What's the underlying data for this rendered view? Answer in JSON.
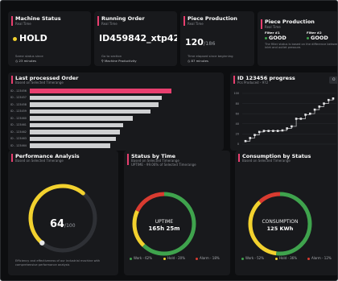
{
  "colors": {
    "accent": "#e83f6f",
    "yellow": "#f2d12e",
    "green": "#3fa34d",
    "red": "#d93b30",
    "orange": "#e07a1f",
    "bar": "#cfd0d2"
  },
  "machine_status": {
    "title": "Machine Status",
    "subtitle": "Real Time",
    "value": "HOLD",
    "footer_note": "Same status since",
    "footer_time": "23 minutes"
  },
  "running_order": {
    "title": "Running Order",
    "subtitle": "Real Time",
    "value": "ID459842_xtp42",
    "footer_note": "Go to section",
    "footer_link": "Machine Productivity"
  },
  "piece_production": {
    "title": "Piece Production",
    "subtitle": "Real Time",
    "value": "120",
    "total": "/186",
    "footer_note": "Time elapsed since beginning",
    "footer_time": "87 minutes"
  },
  "piece_production_filters": {
    "title": "Piece Production",
    "subtitle": "Real Time",
    "filter1_label": "Filter #1",
    "filter1_value": "GOOD",
    "filter2_label": "Filter #2",
    "filter2_value": "GOOD",
    "note": "The filter status is based on the difference between inlet and outlet pressure."
  },
  "last_processed_order": {
    "title": "Last processed Order",
    "subtitle": "Based on Selected Timerange",
    "chart_data": {
      "type": "bar",
      "orientation": "horizontal",
      "categories": [
        "ID - 123456",
        "ID - 123457",
        "ID - 123458",
        "ID - 123459",
        "ID - 123460",
        "ID - 123461",
        "ID - 123462",
        "ID - 123463",
        "ID - 123464"
      ],
      "values": [
        77,
        72,
        70,
        66,
        56,
        51,
        49,
        47,
        44
      ],
      "highlight_index": 0,
      "xticks": [
        "0",
        "8",
        "16",
        "24",
        "32",
        "40",
        "48",
        "56",
        "64",
        "72",
        "80",
        "90",
        "100"
      ],
      "xlim": [
        0,
        100
      ]
    }
  },
  "id_progress": {
    "title": "ID 123456 progress",
    "subtitle": "Pcs Produced - 972",
    "button_label": "O",
    "chart_data": {
      "type": "line",
      "x": [
        1,
        2,
        3,
        4,
        5,
        6,
        7,
        8,
        9,
        10,
        11,
        12,
        13,
        14,
        15,
        16,
        17,
        18,
        19,
        20
      ],
      "values": [
        6,
        12,
        18,
        24,
        26,
        26,
        26,
        26,
        27,
        31,
        35,
        50,
        50,
        58,
        60,
        68,
        74,
        80,
        87,
        90
      ],
      "yticks": [
        "100",
        "80",
        "60",
        "40",
        "20",
        "0"
      ],
      "ylim": [
        0,
        100
      ]
    }
  },
  "performance_analysis": {
    "title": "Performance Analysis",
    "subtitle": "Based on Selected Timerange",
    "value": "64",
    "max": "/100",
    "gauge_fraction": 0.64,
    "note": "Efficiency and effectiveness of our industrial machine with comprehensive performance analysis"
  },
  "status_by_time": {
    "title": "Status by Time",
    "subtitle": "Based on Selected Timerange",
    "subtitle2": "UPTIME - 99.06% of Selected Timerange",
    "center_label": "UPTIME",
    "center_value": "165h 25m",
    "segments": [
      {
        "label": "Work",
        "percent": 62,
        "color": "#3fa34d"
      },
      {
        "label": "Hold",
        "percent": 20,
        "color": "#f2d12e"
      },
      {
        "label": "Alarm",
        "percent": 18,
        "color": "#d93b30"
      }
    ],
    "legend": [
      "• Work - 62%",
      "• Hold - 20%",
      "• Alarm - 18%"
    ]
  },
  "consumption_by_status": {
    "title": "Consumption by Status",
    "subtitle": "Based on Selected Timerange",
    "center_label": "CONSUMPTION",
    "center_value": "125 KWh",
    "segments": [
      {
        "label": "Work",
        "percent": 52,
        "color": "#3fa34d"
      },
      {
        "label": "Hold",
        "percent": 36,
        "color": "#f2d12e"
      },
      {
        "label": "Alarm",
        "percent": 12,
        "color": "#d93b30"
      }
    ],
    "legend": [
      "• Work - 52%",
      "• Hold - 36%",
      "• Alarm - 12%"
    ]
  }
}
